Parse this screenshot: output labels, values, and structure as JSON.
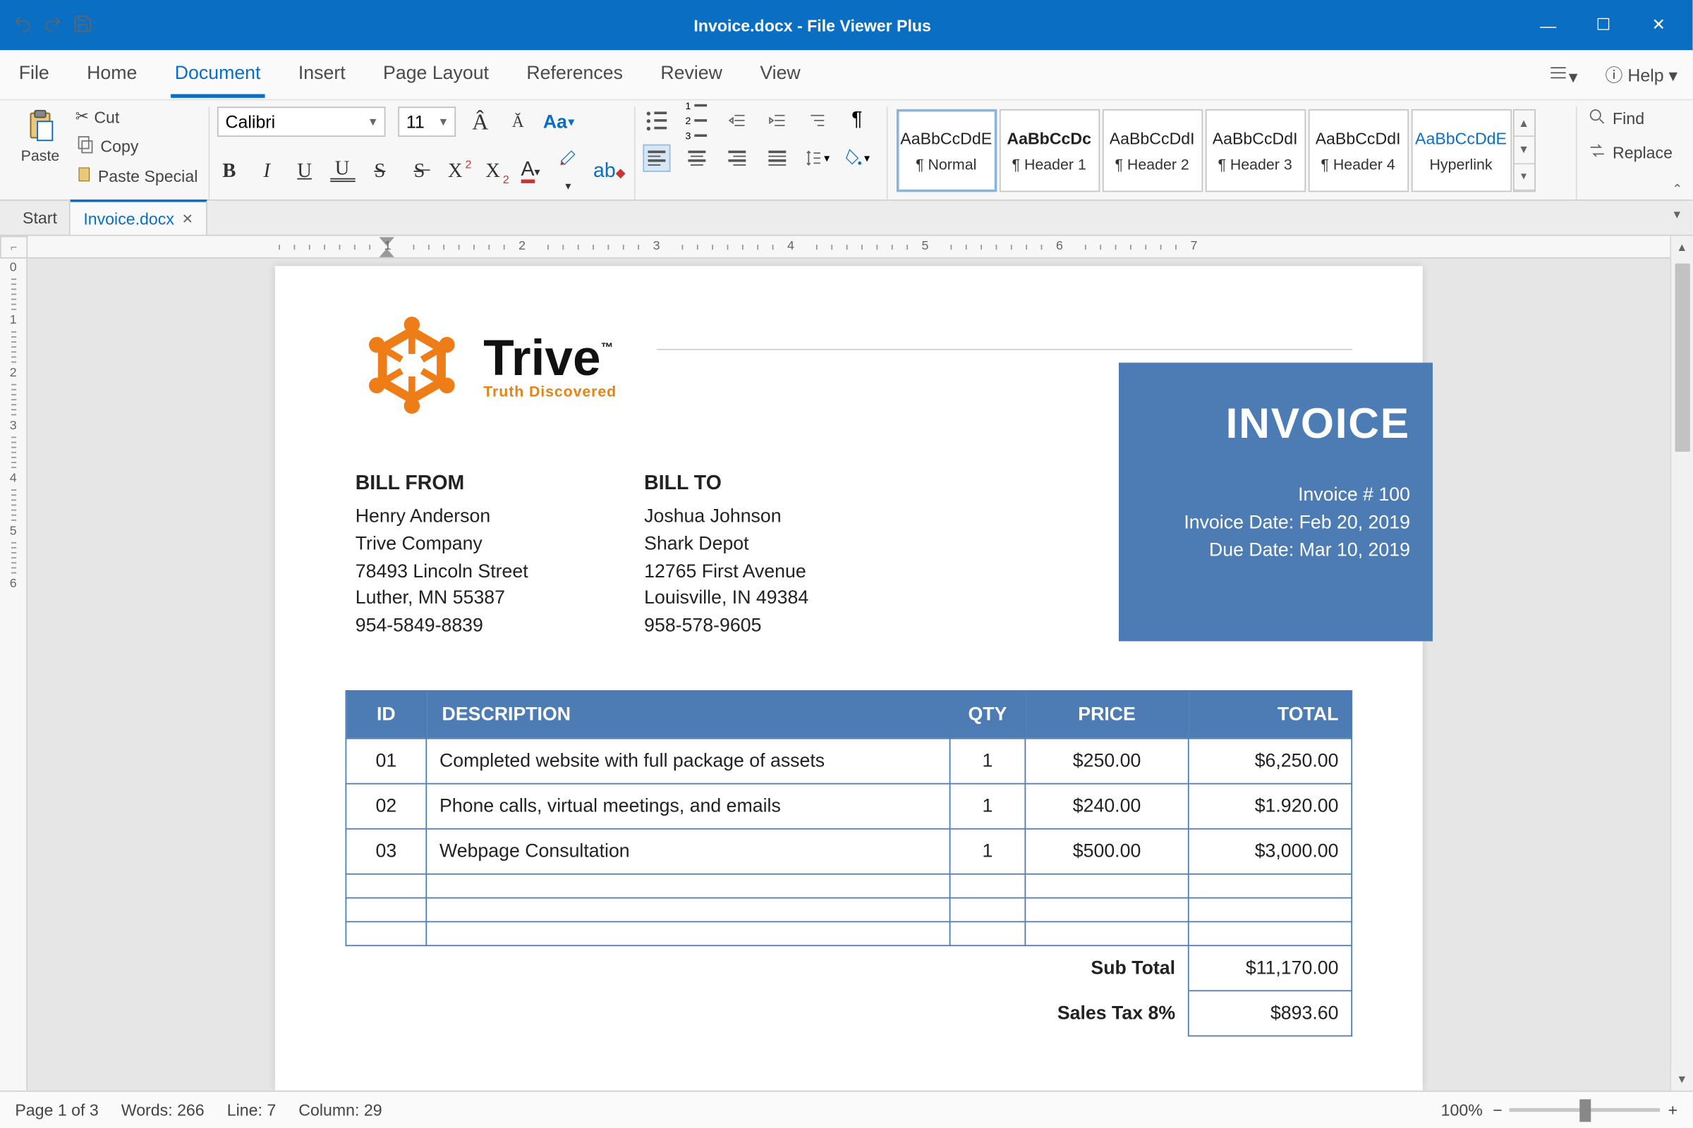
{
  "titlebar": {
    "title": "Invoice.docx - File Viewer Plus"
  },
  "menubar": {
    "items": [
      "File",
      "Home",
      "Document",
      "Insert",
      "Page Layout",
      "References",
      "Review",
      "View"
    ],
    "active_index": 2,
    "help_label": "Help"
  },
  "ribbon": {
    "clipboard": {
      "paste": "Paste",
      "cut": "Cut",
      "copy": "Copy",
      "paste_special": "Paste Special"
    },
    "font": {
      "name": "Calibri",
      "size": "11",
      "case_label": "Aa"
    },
    "styles": [
      {
        "preview": "AaBbCcDdE",
        "label": "¶ Normal",
        "color": "#222"
      },
      {
        "preview": "AaBbCcDc",
        "label": "¶ Header 1",
        "color": "#222",
        "bold": true
      },
      {
        "preview": "AaBbCcDdI",
        "label": "¶ Header 2",
        "color": "#222"
      },
      {
        "preview": "AaBbCcDdI",
        "label": "¶ Header 3",
        "color": "#222"
      },
      {
        "preview": "AaBbCcDdI",
        "label": "¶ Header 4",
        "color": "#222"
      },
      {
        "preview": "AaBbCcDdE",
        "label": "Hyperlink",
        "color": "#0a6fc2"
      }
    ],
    "editing": {
      "find": "Find",
      "replace": "Replace"
    }
  },
  "tabs": {
    "start": "Start",
    "doc": "Invoice.docx"
  },
  "document": {
    "logo": {
      "brand": "Trive",
      "tagline": "Truth Discovered"
    },
    "bill_from": {
      "heading": "BILL FROM",
      "lines": [
        "Henry Anderson",
        "Trive Company",
        "78493 Lincoln Street",
        "Luther, MN 55387",
        "954-5849-8839"
      ]
    },
    "bill_to": {
      "heading": "BILL TO",
      "lines": [
        "Joshua Johnson",
        "Shark Depot",
        "12765 First Avenue",
        "Louisville, IN 49384",
        "958-578-9605"
      ]
    },
    "invoice_block": {
      "title": "INVOICE",
      "lines": [
        "Invoice # 100",
        "Invoice Date: Feb 20, 2019",
        "Due Date: Mar 10, 2019"
      ]
    },
    "table": {
      "headers": {
        "id": "ID",
        "desc": "DESCRIPTION",
        "qty": "QTY",
        "price": "PRICE",
        "total": "TOTAL"
      },
      "rows": [
        {
          "id": "01",
          "desc": "Completed website with full package of assets",
          "qty": "1",
          "price": "$250.00",
          "total": "$6,250.00"
        },
        {
          "id": "02",
          "desc": "Phone calls, virtual meetings, and emails",
          "qty": "1",
          "price": "$240.00",
          "total": "$1.920.00"
        },
        {
          "id": "03",
          "desc": "Webpage Consultation",
          "qty": "1",
          "price": "$500.00",
          "total": "$3,000.00"
        },
        {
          "id": "",
          "desc": "",
          "qty": "",
          "price": "",
          "total": ""
        },
        {
          "id": "",
          "desc": "",
          "qty": "",
          "price": "",
          "total": ""
        },
        {
          "id": "",
          "desc": "",
          "qty": "",
          "price": "",
          "total": ""
        }
      ],
      "totals": [
        {
          "label": "Sub Total",
          "value": "$11,170.00"
        },
        {
          "label": "Sales Tax 8%",
          "value": "$893.60"
        }
      ]
    }
  },
  "statusbar": {
    "page": "Page 1 of 3",
    "words": "Words: 266",
    "line": "Line: 7",
    "column": "Column: 29",
    "zoom": "100%"
  }
}
